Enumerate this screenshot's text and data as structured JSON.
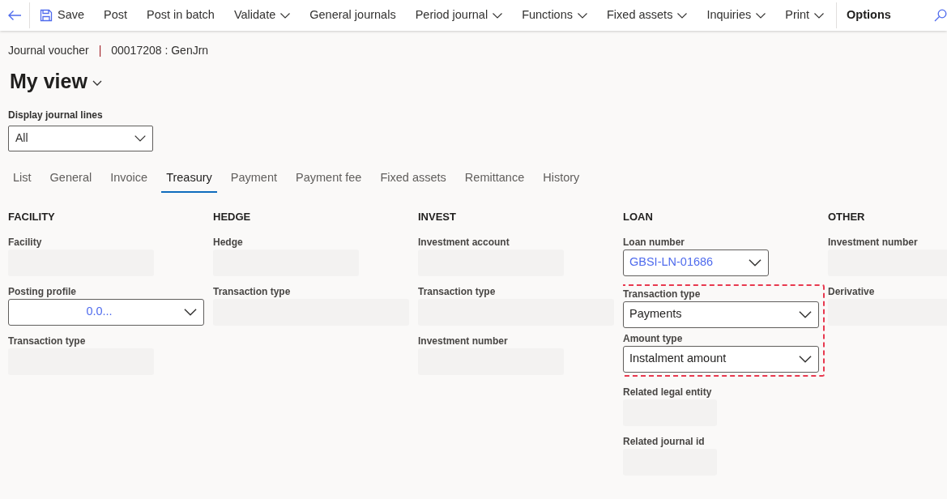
{
  "toolbar": {
    "items": [
      {
        "label": "Save",
        "kind": "save"
      },
      {
        "label": "Post",
        "kind": "plain"
      },
      {
        "label": "Post in batch",
        "kind": "plain"
      },
      {
        "label": "Validate",
        "kind": "menu"
      },
      {
        "label": "General journals",
        "kind": "plain"
      },
      {
        "label": "Period journal",
        "kind": "menu"
      },
      {
        "label": "Functions",
        "kind": "menu"
      },
      {
        "label": "Fixed assets",
        "kind": "menu"
      },
      {
        "label": "Inquiries",
        "kind": "menu"
      },
      {
        "label": "Print",
        "kind": "menu"
      },
      {
        "label": "Options",
        "kind": "strong"
      }
    ]
  },
  "breadcrumb": {
    "page": "Journal voucher",
    "separator": "|",
    "record": "00017208 : GenJrn"
  },
  "view_title": "My view",
  "display_lines": {
    "label": "Display journal lines",
    "value": "All"
  },
  "tabs": [
    {
      "label": "List",
      "selected": false
    },
    {
      "label": "General",
      "selected": false
    },
    {
      "label": "Invoice",
      "selected": false
    },
    {
      "label": "Treasury",
      "selected": true
    },
    {
      "label": "Payment",
      "selected": false
    },
    {
      "label": "Payment fee",
      "selected": false
    },
    {
      "label": "Fixed assets",
      "selected": false
    },
    {
      "label": "Remittance",
      "selected": false
    },
    {
      "label": "History",
      "selected": false
    }
  ],
  "sections": [
    {
      "title": "FACILITY",
      "fields": [
        {
          "label": "Facility",
          "kind": "readonly"
        },
        {
          "label": "Posting profile",
          "kind": "dropdown",
          "value": "0.0...",
          "link": true
        },
        {
          "label": "Transaction type",
          "kind": "readonly"
        }
      ]
    },
    {
      "title": "HEDGE",
      "fields": [
        {
          "label": "Hedge",
          "kind": "readonly"
        },
        {
          "label": "Transaction type",
          "kind": "readonly"
        }
      ]
    },
    {
      "title": "INVEST",
      "fields": [
        {
          "label": "Investment account",
          "kind": "readonly"
        },
        {
          "label": "Transaction type",
          "kind": "readonly"
        },
        {
          "label": "Investment number",
          "kind": "readonly"
        }
      ]
    },
    {
      "title": "LOAN",
      "fields": [
        {
          "label": "Loan number",
          "kind": "dropdown",
          "value": "GBSI-LN-01686",
          "link": true,
          "highlighted": false
        },
        {
          "label": "Transaction type",
          "kind": "dropdown",
          "value": "Payments",
          "link": false,
          "highlighted": true
        },
        {
          "label": "Amount type",
          "kind": "dropdown",
          "value": "Instalment amount",
          "link": false,
          "highlighted": true
        },
        {
          "label": "Related legal entity",
          "kind": "readonly",
          "highlighted": false
        },
        {
          "label": "Related journal id",
          "kind": "readonly",
          "highlighted": false
        }
      ]
    },
    {
      "title": "OTHER",
      "fields": [
        {
          "label": "Investment number",
          "kind": "readonly"
        },
        {
          "label": "Derivative",
          "kind": "readonly"
        }
      ]
    }
  ]
}
